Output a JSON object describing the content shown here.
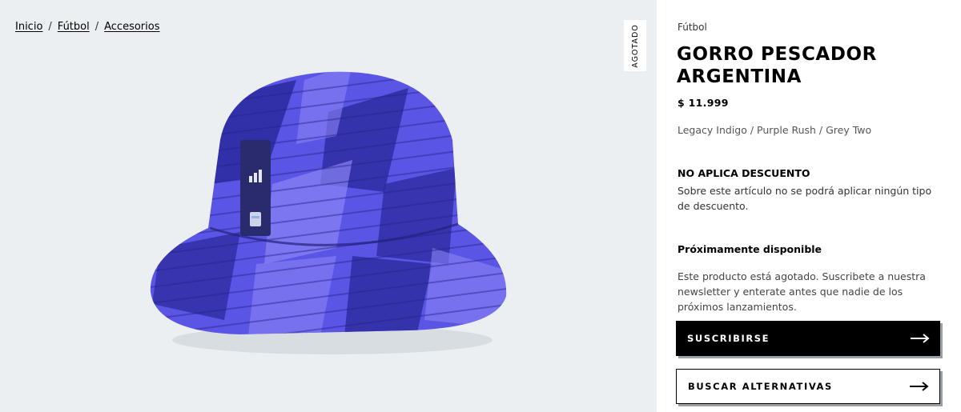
{
  "breadcrumb": {
    "items": [
      "Inicio",
      "Fútbol",
      "Accesorios"
    ],
    "separator": "/"
  },
  "badge": {
    "label": "AGOTADO"
  },
  "product": {
    "category": "Fútbol",
    "title": "GORRO PESCADOR ARGENTINA",
    "price": "$ 11.999",
    "color": "Legacy Indigo / Purple Rush / Grey Two"
  },
  "discount": {
    "title": "NO APLICA DESCUENTO",
    "text": "Sobre este artículo no se podrá aplicar ningún tipo de descuento."
  },
  "availability": {
    "title": "Próximamente disponible",
    "text": "Este producto está agotado. Suscribete a nuestra newsletter y enterate antes que nadie de los próximos lanzamientos."
  },
  "buttons": {
    "subscribe": "SUSCRIBIRSE",
    "alternatives": "BUSCAR ALTERNATIVAS"
  },
  "colors": {
    "gallery_bg": "#eceff1",
    "hat_base": "#5b55e6",
    "hat_dark": "#2c2a9e",
    "hat_light": "#8a84f5"
  },
  "icons": {
    "arrow": "arrow-right-icon"
  }
}
